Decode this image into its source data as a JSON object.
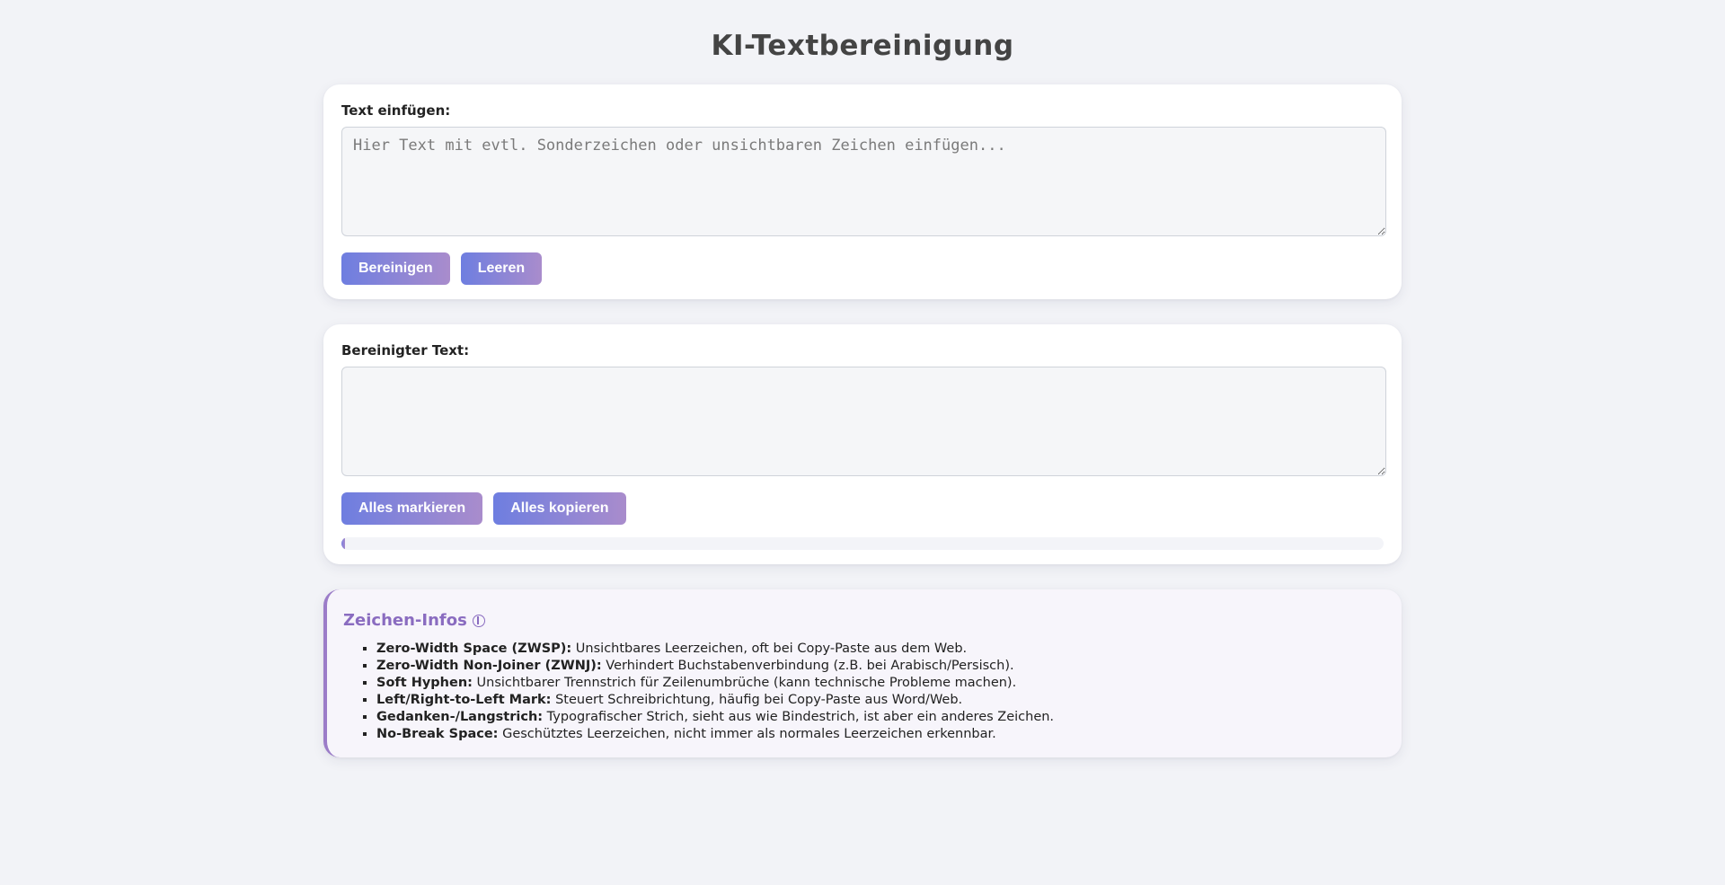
{
  "header": {
    "title": "KI-Textbereinigung"
  },
  "input_section": {
    "label": "Text einfügen:",
    "placeholder": "Hier Text mit evtl. Sonderzeichen oder unsichtbaren Zeichen einfügen...",
    "value": "",
    "clean_button": "Bereinigen",
    "clear_button": "Leeren"
  },
  "output_section": {
    "label": "Bereinigter Text:",
    "value": "",
    "select_all_button": "Alles markieren",
    "copy_all_button": "Alles kopieren",
    "progress_fraction": 0.003
  },
  "info": {
    "title": "Zeichen-Infos",
    "icon": "info-icon",
    "items": [
      {
        "term": "Zero-Width Space (ZWSP):",
        "desc": " Unsichtbares Leerzeichen, oft bei Copy-Paste aus dem Web."
      },
      {
        "term": "Zero-Width Non-Joiner (ZWNJ):",
        "desc": " Verhindert Buchstabenverbindung (z.B. bei Arabisch/Persisch)."
      },
      {
        "term": "Soft Hyphen:",
        "desc": " Unsichtbarer Trennstrich für Zeilenumbrüche (kann technische Probleme machen)."
      },
      {
        "term": "Left/Right-to-Left Mark:",
        "desc": " Steuert Schreibrichtung, häufig bei Copy-Paste aus Word/Web."
      },
      {
        "term": "Gedanken-/Langstrich:",
        "desc": " Typografischer Strich, sieht aus wie Bindestrich, ist aber ein anderes Zeichen."
      },
      {
        "term": "No-Break Space:",
        "desc": " Geschütztes Leerzeichen, nicht immer als normales Leerzeichen erkennbar."
      }
    ]
  },
  "colors": {
    "accent": "#9b7cc8",
    "button_gradient_start": "#6e7ee0",
    "button_gradient_end": "#a98ccc"
  }
}
